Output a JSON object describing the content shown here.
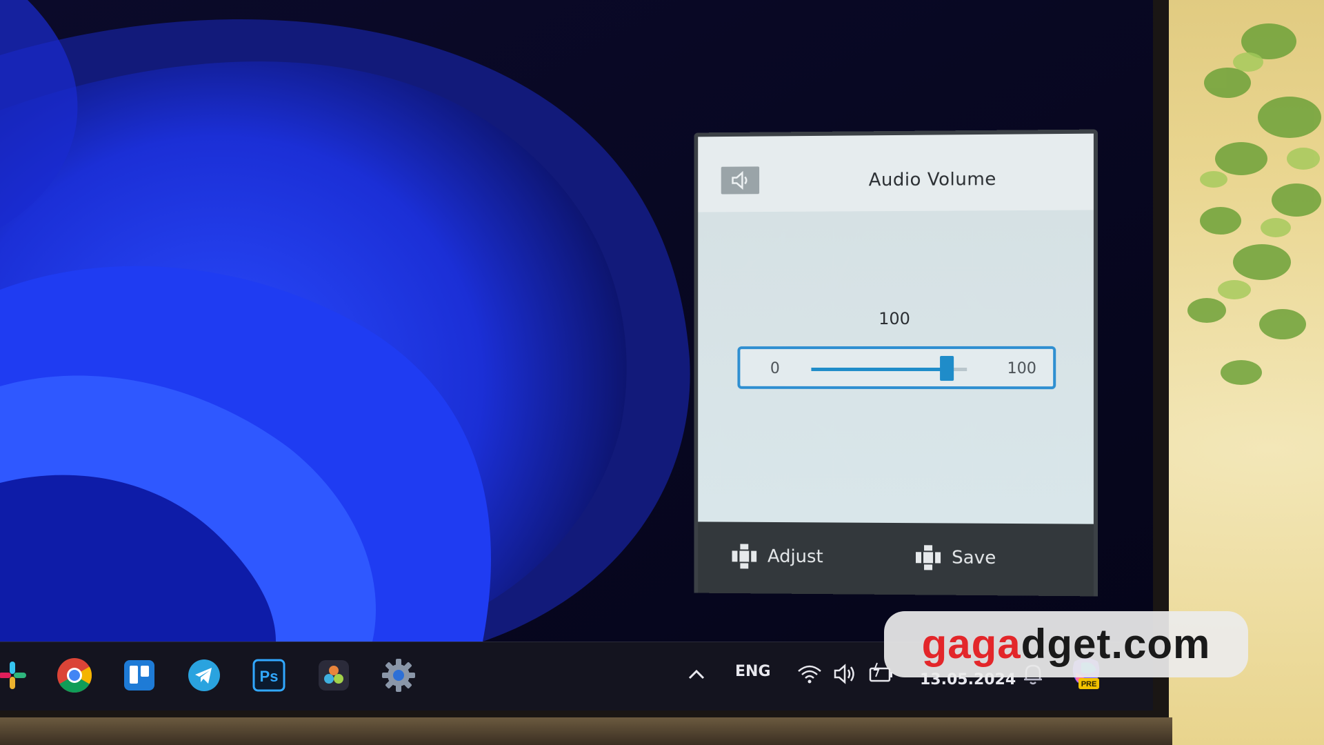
{
  "osd": {
    "title": "Audio Volume",
    "value": "100",
    "slider": {
      "min_label": "0",
      "max_label": "100",
      "level": 0.87
    },
    "footer": {
      "adjust_label": "Adjust",
      "save_label": "Save"
    },
    "accent_color": "#1f8cc9"
  },
  "taskbar": {
    "apps": [
      "slack-icon",
      "chrome-icon",
      "trello-icon",
      "telegram-icon",
      "photoshop-icon",
      "davinci-resolve-icon",
      "settings-icon"
    ],
    "photoshop_label": "Ps",
    "language": "ENG",
    "date": "13.05.2024",
    "copilot_badge": "PRE"
  },
  "watermark": {
    "text": "gagadget.com",
    "accent_color": "#e3262a"
  }
}
